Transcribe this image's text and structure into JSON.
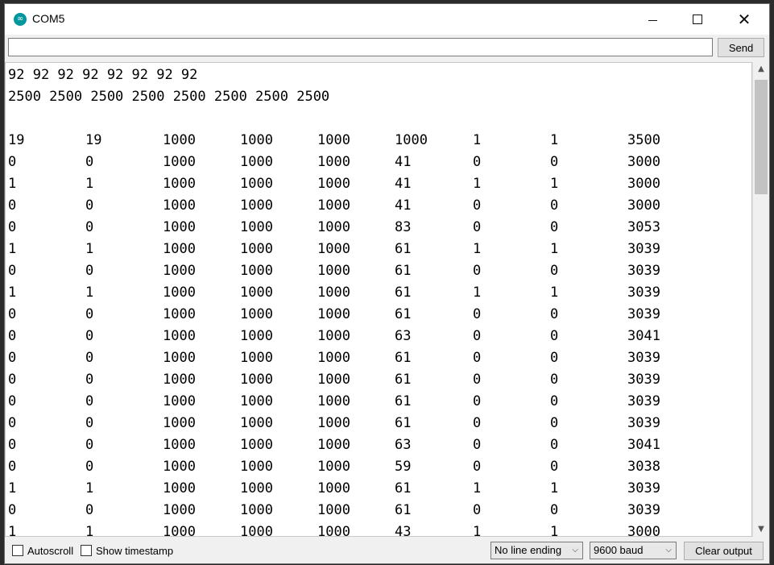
{
  "window": {
    "title": "COM5",
    "icon": "arduino-infinity-icon",
    "accent": "#00979c"
  },
  "send": {
    "input_value": "",
    "button_label": "Send"
  },
  "output": {
    "header_lines": [
      "92 92 92 92 92 92 92 92",
      "2500 2500 2500 2500 2500 2500 2500 2500"
    ],
    "rows": [
      [
        "19",
        "19",
        "1000",
        "1000",
        "1000",
        "1000",
        "1",
        "1",
        "3500"
      ],
      [
        "0",
        "0",
        "1000",
        "1000",
        "1000",
        "41",
        "0",
        "0",
        "3000"
      ],
      [
        "1",
        "1",
        "1000",
        "1000",
        "1000",
        "41",
        "1",
        "1",
        "3000"
      ],
      [
        "0",
        "0",
        "1000",
        "1000",
        "1000",
        "41",
        "0",
        "0",
        "3000"
      ],
      [
        "0",
        "0",
        "1000",
        "1000",
        "1000",
        "83",
        "0",
        "0",
        "3053"
      ],
      [
        "1",
        "1",
        "1000",
        "1000",
        "1000",
        "61",
        "1",
        "1",
        "3039"
      ],
      [
        "0",
        "0",
        "1000",
        "1000",
        "1000",
        "61",
        "0",
        "0",
        "3039"
      ],
      [
        "1",
        "1",
        "1000",
        "1000",
        "1000",
        "61",
        "1",
        "1",
        "3039"
      ],
      [
        "0",
        "0",
        "1000",
        "1000",
        "1000",
        "61",
        "0",
        "0",
        "3039"
      ],
      [
        "0",
        "0",
        "1000",
        "1000",
        "1000",
        "63",
        "0",
        "0",
        "3041"
      ],
      [
        "0",
        "0",
        "1000",
        "1000",
        "1000",
        "61",
        "0",
        "0",
        "3039"
      ],
      [
        "0",
        "0",
        "1000",
        "1000",
        "1000",
        "61",
        "0",
        "0",
        "3039"
      ],
      [
        "0",
        "0",
        "1000",
        "1000",
        "1000",
        "61",
        "0",
        "0",
        "3039"
      ],
      [
        "0",
        "0",
        "1000",
        "1000",
        "1000",
        "61",
        "0",
        "0",
        "3039"
      ],
      [
        "0",
        "0",
        "1000",
        "1000",
        "1000",
        "63",
        "0",
        "0",
        "3041"
      ],
      [
        "0",
        "0",
        "1000",
        "1000",
        "1000",
        "59",
        "0",
        "0",
        "3038"
      ],
      [
        "1",
        "1",
        "1000",
        "1000",
        "1000",
        "61",
        "1",
        "1",
        "3039"
      ],
      [
        "0",
        "0",
        "1000",
        "1000",
        "1000",
        "61",
        "0",
        "0",
        "3039"
      ],
      [
        "1",
        "1",
        "1000",
        "1000",
        "1000",
        "43",
        "1",
        "1",
        "3000"
      ]
    ]
  },
  "bottom": {
    "autoscroll_label": "Autoscroll",
    "autoscroll_checked": false,
    "timestamp_label": "Show timestamp",
    "timestamp_checked": false,
    "line_ending": "No line ending",
    "baud": "9600 baud",
    "clear_label": "Clear output"
  }
}
